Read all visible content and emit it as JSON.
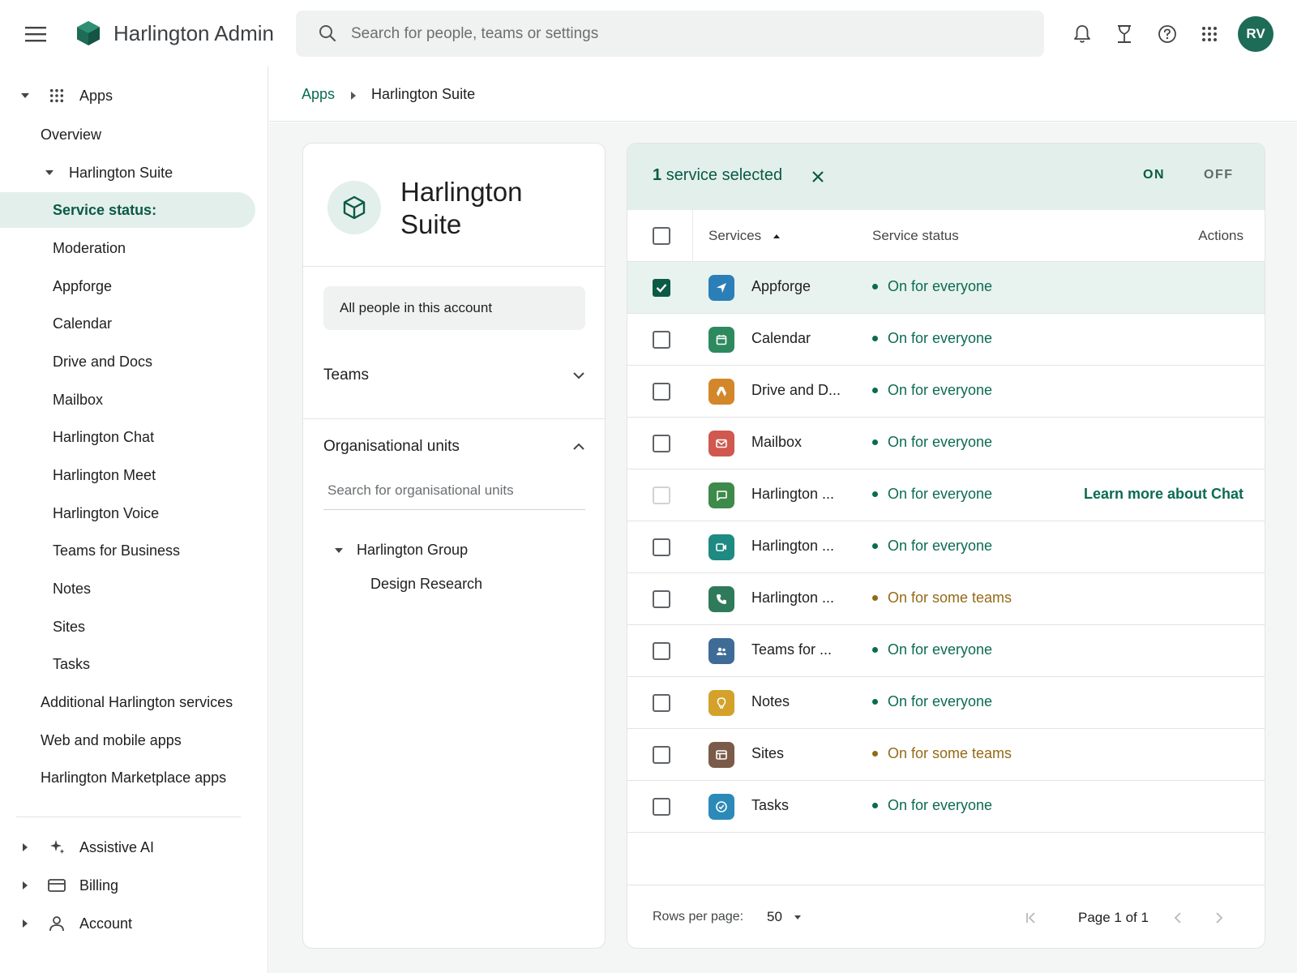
{
  "header": {
    "app_title": "Harlington Admin",
    "search_placeholder": "Search for people, teams or settings",
    "avatar_initials": "RV",
    "brand_color": "#1e6b57"
  },
  "sidebar": {
    "apps_label": "Apps",
    "overview_label": "Overview",
    "suite_label": "Harlington Suite",
    "suite_children": [
      "Service status:",
      "Moderation",
      "Appforge",
      "Calendar",
      "Drive and Docs",
      "Mailbox",
      "Harlington Chat",
      "Harlington Meet",
      "Harlington Voice",
      "Teams for Business",
      "Notes",
      "Sites",
      "Tasks"
    ],
    "active_item": "Service status:",
    "more_items": [
      "Additional Harlington services",
      "Web and mobile apps",
      "Harlington Marketplace apps"
    ],
    "bottom_items": [
      {
        "label": "Assistive AI",
        "icon": "sparkle-icon"
      },
      {
        "label": "Billing",
        "icon": "credit-card-icon"
      },
      {
        "label": "Account",
        "icon": "person-icon"
      }
    ]
  },
  "breadcrumb": {
    "parent": "Apps",
    "current": "Harlington Suite"
  },
  "left_panel": {
    "title": "Harlington Suite",
    "all_people_label": "All people in this account",
    "teams_label": "Teams",
    "org_units_label": "Organisational units",
    "org_search_placeholder": "Search for organisational units",
    "org_tree": {
      "root": "Harlington Group",
      "children": [
        "Design Research"
      ]
    }
  },
  "services_panel": {
    "selection_count": "1",
    "selection_text": "service selected",
    "on_label": "ON",
    "off_label": "OFF",
    "columns": {
      "services": "Services",
      "status": "Service status",
      "actions": "Actions"
    },
    "rows": [
      {
        "name": "Appforge",
        "status": "On for everyone",
        "status_type": "everyone",
        "checked": true,
        "disabled": false,
        "icon": "navigation-arrow-icon",
        "color": "#2b7fb8",
        "action": ""
      },
      {
        "name": "Calendar",
        "status": "On for everyone",
        "status_type": "everyone",
        "checked": false,
        "disabled": false,
        "icon": "calendar-icon",
        "color": "#2e8a5e",
        "action": ""
      },
      {
        "name": "Drive and D...",
        "status": "On for everyone",
        "status_type": "everyone",
        "checked": false,
        "disabled": false,
        "icon": "drive-icon",
        "color": "#d4862a",
        "action": ""
      },
      {
        "name": "Mailbox",
        "status": "On for everyone",
        "status_type": "everyone",
        "checked": false,
        "disabled": false,
        "icon": "mail-icon",
        "color": "#d0584f",
        "action": ""
      },
      {
        "name": "Harlington ...",
        "status": "On for everyone",
        "status_type": "everyone",
        "checked": false,
        "disabled": true,
        "icon": "chat-bubble-icon",
        "color": "#3d8a4a",
        "action": "Learn more about Chat"
      },
      {
        "name": "Harlington ...",
        "status": "On for everyone",
        "status_type": "everyone",
        "checked": false,
        "disabled": false,
        "icon": "video-camera-icon",
        "color": "#1e8a82",
        "action": ""
      },
      {
        "name": "Harlington ...",
        "status": "On for some teams",
        "status_type": "some",
        "checked": false,
        "disabled": false,
        "icon": "phone-icon",
        "color": "#2f7a5b",
        "action": ""
      },
      {
        "name": "Teams for ...",
        "status": "On for everyone",
        "status_type": "everyone",
        "checked": false,
        "disabled": false,
        "icon": "people-icon",
        "color": "#3e6c97",
        "action": ""
      },
      {
        "name": "Notes",
        "status": "On for everyone",
        "status_type": "everyone",
        "checked": false,
        "disabled": false,
        "icon": "lightbulb-icon",
        "color": "#d4a22a",
        "action": ""
      },
      {
        "name": "Sites",
        "status": "On for some teams",
        "status_type": "some",
        "checked": false,
        "disabled": false,
        "icon": "web-layout-icon",
        "color": "#7a5b49",
        "action": ""
      },
      {
        "name": "Tasks",
        "status": "On for everyone",
        "status_type": "everyone",
        "checked": false,
        "disabled": false,
        "icon": "check-circle-icon",
        "color": "#2b8ab8",
        "action": ""
      }
    ],
    "status_colors": {
      "everyone": "#0b6b52",
      "some": "#946a16"
    },
    "footer": {
      "rows_per_page_label": "Rows per page:",
      "rows_per_page_value": "50",
      "page_info": "Page 1 of 1"
    }
  }
}
